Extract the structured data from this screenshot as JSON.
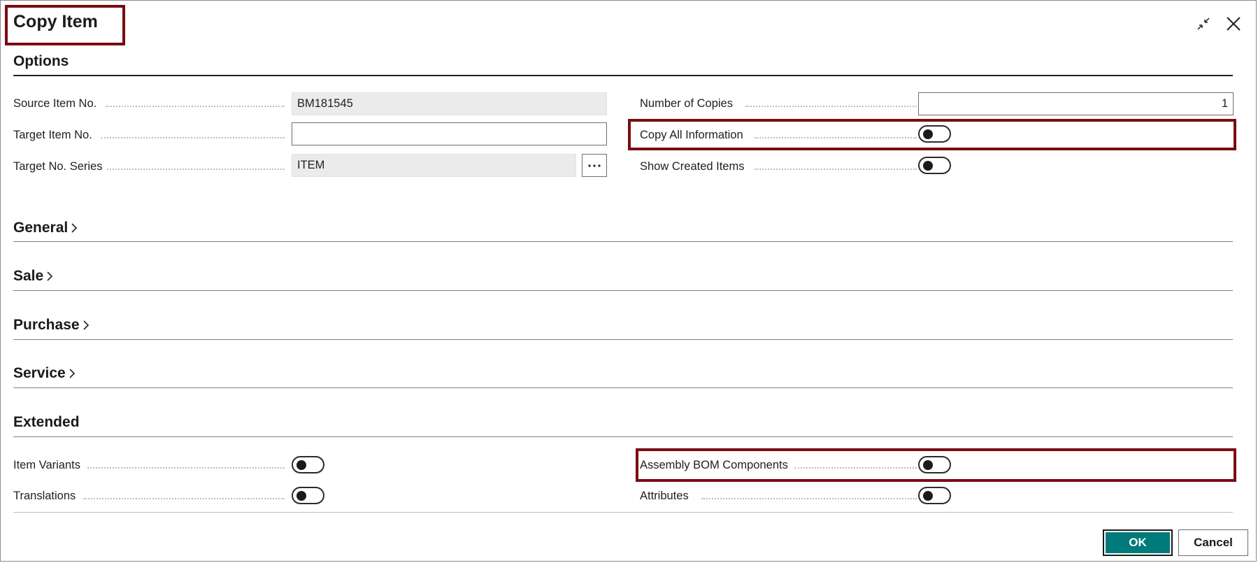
{
  "dialog": {
    "title": "Copy Item",
    "collapse_icon": "collapse-arrows-icon",
    "close_icon": "close-icon"
  },
  "options": {
    "heading": "Options",
    "source_item_no": {
      "label": "Source Item No.",
      "value": "BM181545"
    },
    "target_item_no": {
      "label": "Target Item No.",
      "value": ""
    },
    "target_no_series": {
      "label": "Target No. Series",
      "value": "ITEM",
      "lookup_icon": "ellipsis-icon"
    },
    "number_of_copies": {
      "label": "Number of Copies",
      "value": "1"
    },
    "copy_all_information": {
      "label": "Copy All Information",
      "on": false
    },
    "show_created_items": {
      "label": "Show Created Items",
      "on": false
    }
  },
  "sections": {
    "general": "General",
    "sale": "Sale",
    "purchase": "Purchase",
    "service": "Service",
    "extended": "Extended"
  },
  "extended": {
    "item_variants": {
      "label": "Item Variants",
      "on": false
    },
    "translations": {
      "label": "Translations",
      "on": false
    },
    "assembly_bom_components": {
      "label": "Assembly BOM Components",
      "on": false
    },
    "attributes": {
      "label": "Attributes",
      "on": false
    }
  },
  "footer": {
    "ok_label": "OK",
    "cancel_label": "Cancel"
  },
  "colors": {
    "highlight": "#7a0c12",
    "ok_button": "#007a7a"
  }
}
